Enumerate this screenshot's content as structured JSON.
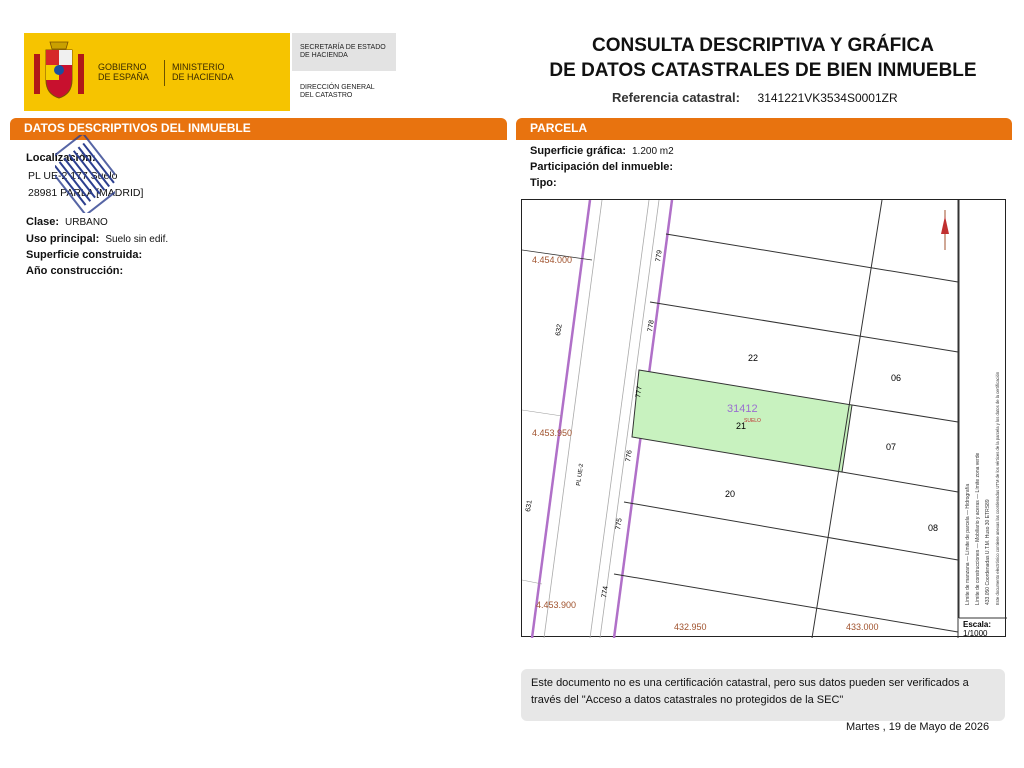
{
  "header": {
    "logo_left_line1": "GOBIERNO",
    "logo_left_line2": "DE ESPAÑA",
    "logo_right_line1": "MINISTERIO",
    "logo_right_line2": "DE HACIENDA",
    "org1_line1": "SECRETARÍA DE ESTADO",
    "org1_line2": "DE HACIENDA",
    "org2_line1": "DIRECCIÓN GENERAL",
    "org2_line2": "DEL CATASTRO",
    "title_line1": "CONSULTA DESCRIPTIVA Y GRÁFICA",
    "title_line2": "DE DATOS CATASTRALES DE BIEN INMUEBLE",
    "ref_label": "Referencia catastral:",
    "ref_value": "3141221VK3534S0001ZR"
  },
  "left": {
    "section_title": "DATOS DESCRIPTIVOS DEL INMUEBLE",
    "localizacion_label": "Localización:",
    "address_line1": "PL UE-2 177 Suelo",
    "address_line2": "28981 PARLA [MADRID]",
    "clase_label": "Clase:",
    "clase_value": "URBANO",
    "uso_label": "Uso principal:",
    "uso_value": "Suelo sin edif.",
    "superficie_label": "Superficie construida:",
    "anio_label": "Año construcción:",
    "stamp_text": "R.A.I.S.L."
  },
  "right": {
    "section_title": "PARCELA",
    "superficie_label": "Superficie gráfica:",
    "superficie_value": "1.200 m2",
    "participacion_label": "Participación del inmueble:",
    "tipo_label": "Tipo:"
  },
  "map": {
    "y_labels": [
      "4.454.000",
      "4.453.950",
      "4.453.900"
    ],
    "x_labels": [
      "432.950",
      "433.000"
    ],
    "parcel_number": "31412",
    "parcel_sub": "SUELO",
    "street_name": "PL UE-2",
    "street_numbers": [
      "779",
      "778",
      "777",
      "776",
      "775",
      "774"
    ],
    "left_street_numbers": [
      "632",
      "631"
    ],
    "block_numbers": [
      "22",
      "21",
      "20",
      "06",
      "07",
      "08"
    ],
    "escala_label": "Escala:",
    "escala_value": "1/1000",
    "legend_line1": "Límite de manzana — Límite de parcela — Hidrografía",
    "legend_line2": "Límite de construcciones — Mobiliario y aceras — Límite zona verde",
    "legend_line3": "433.050 Coordenadas U.T.M. Huso 30 ETRS89",
    "legend_line4": "Este documento electrónico contiene anexas las coordenadas UTM de los vértices de la parcela y los datos de la certificación",
    "colors": {
      "parcel_fill": "#c8f2bf",
      "street_line": "#b070c8",
      "coord": "#a0522d",
      "parcel_text": "#9a6fd0"
    }
  },
  "footer": {
    "notice_line1": "Este documento no es una certificación catastral, pero sus datos pueden ser verificados a",
    "notice_line2": "través del \"Acceso a datos catastrales no protegidos de la SEC\"",
    "date": "Martes , 19 de Mayo de 2026"
  }
}
